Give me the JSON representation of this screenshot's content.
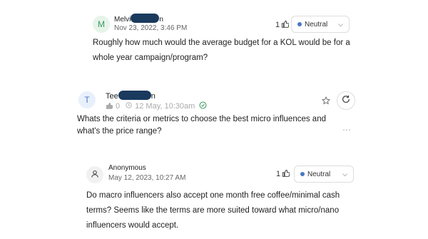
{
  "comments": [
    {
      "avatar_letter": "M",
      "author": "Melvi",
      "author_tail": "n",
      "timestamp": "Nov 23, 2022, 3:46 PM",
      "likes": "1",
      "sentiment": "Neutral",
      "text_lines": [
        "Roughly how much would the average budget for a KOL would be for a",
        "whole year campaign/program?"
      ]
    },
    {
      "avatar_letter": "T",
      "author": "Tee",
      "author_tail": "n",
      "likes": "0",
      "timestamp": "12 May, 10:30am",
      "text_lines": [
        "Whats the criteria or metrics to choose the best micro influences and",
        "what's the price range?"
      ]
    },
    {
      "author": "Anonymous",
      "timestamp": "May 12, 2023, 10:27 AM",
      "likes": "1",
      "sentiment": "Neutral",
      "text_lines": [
        "Do macro influencers also accept one month free coffee/minimal cash",
        "terms? Seems like the terms are more suited toward what micro/nano",
        "influencers would accept."
      ]
    }
  ],
  "icons": {
    "accent": "#4a78c4",
    "check_color": "#3c9a5f"
  }
}
